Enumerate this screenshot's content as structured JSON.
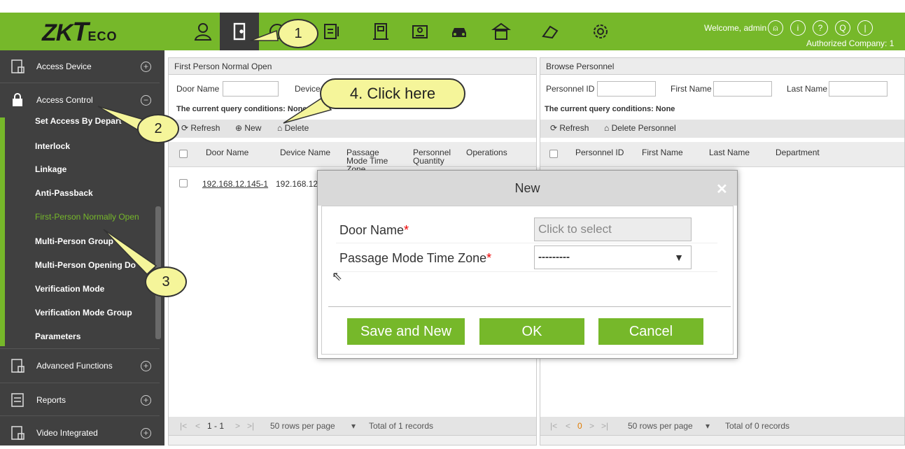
{
  "header": {
    "logo": "ZKTeco",
    "welcome": "Welcome, admin",
    "authorized": "Authorized Company: 1",
    "icons": [
      "person-icon",
      "door-icon",
      "time-icon",
      "attendance-icon",
      "building-icon",
      "visitor-icon",
      "car-icon",
      "patrol-icon",
      "elevator-icon",
      "settings-icon"
    ]
  },
  "sidebar": {
    "sections": [
      {
        "label": "Access Device",
        "expanded": false
      },
      {
        "label": "Access Control",
        "expanded": true
      },
      {
        "label": "Advanced Functions",
        "expanded": false
      },
      {
        "label": "Reports",
        "expanded": false
      },
      {
        "label": "Video Integrated",
        "expanded": false
      }
    ],
    "items": [
      "Set Access By Depart",
      "Interlock",
      "Linkage",
      "Anti-Passback",
      "First-Person Normally Open",
      "Multi-Person Group",
      "Multi-Person Opening Do",
      "Verification Mode",
      "Verification Mode Group",
      "Parameters"
    ],
    "active_item": "First-Person Normally Open"
  },
  "left_panel": {
    "title": "First Person Normal Open",
    "filter_door_label": "Door Name",
    "filter_device_label": "Device",
    "query_conditions": "The current query conditions: None",
    "toolbar": {
      "refresh": "Refresh",
      "new": "New",
      "delete": "Delete"
    },
    "columns": [
      "Door Name",
      "Device Name",
      "Passage Mode Time Zone",
      "Personnel Quantity",
      "Operations"
    ],
    "rows": [
      {
        "door_name": "192.168.12.145-1",
        "device_name": "192.168.12."
      }
    ],
    "footer": {
      "pagination": "1 - 1",
      "rows_per_page": "50 rows per page",
      "total": "Total of 1 records"
    }
  },
  "right_panel": {
    "title": "Browse Personnel",
    "filter_id_label": "Personnel ID",
    "filter_first_label": "First Name",
    "filter_last_label": "Last Name",
    "query_conditions": "The current query conditions: None",
    "toolbar": {
      "refresh": "Refresh",
      "delete_personnel": "Delete Personnel"
    },
    "columns": [
      "Personnel ID",
      "First Name",
      "Last Name",
      "Department"
    ],
    "footer": {
      "page": "0",
      "rows_per_page": "50 rows per page",
      "total": "Total of 0 records"
    }
  },
  "dialog": {
    "title": "New",
    "door_name_label": "Door Name",
    "door_name_value": "Click to select",
    "time_zone_label": "Passage Mode Time Zone",
    "time_zone_value": "---------",
    "save_and_new": "Save and New",
    "ok": "OK",
    "cancel": "Cancel"
  },
  "callouts": {
    "c1": "1",
    "c2": "2",
    "c3": "3",
    "c4": "4. Click here"
  },
  "colors": {
    "brand_green": "#76b82a",
    "sidebar_bg": "#404040",
    "callout_fill": "#f5f59a"
  }
}
